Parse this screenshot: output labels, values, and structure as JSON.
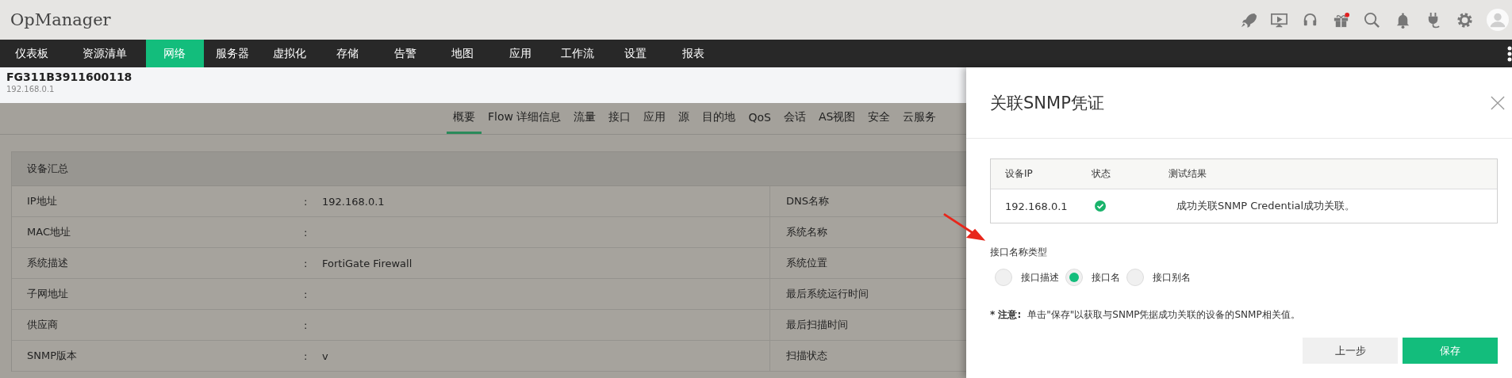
{
  "app": {
    "title": "OpManager"
  },
  "toolbar_icons": [
    {
      "kind": "rocket"
    },
    {
      "kind": "screen"
    },
    {
      "kind": "headset"
    },
    {
      "kind": "gift",
      "badge": true
    },
    {
      "kind": "search"
    },
    {
      "kind": "bell"
    },
    {
      "kind": "plug"
    },
    {
      "kind": "gear"
    },
    {
      "kind": "avatar"
    }
  ],
  "nav": [
    {
      "label": "仪表板",
      "selected": false
    },
    {
      "label": "资源清单",
      "selected": false
    },
    {
      "label": "网络",
      "selected": true
    },
    {
      "label": "服务器",
      "selected": false
    },
    {
      "label": "虚拟化",
      "selected": false
    },
    {
      "label": "存储",
      "selected": false
    },
    {
      "label": "告警",
      "selected": false
    },
    {
      "label": "地图",
      "selected": false
    },
    {
      "label": "应用",
      "selected": false
    },
    {
      "label": "工作流",
      "selected": false
    },
    {
      "label": "设置",
      "selected": false
    },
    {
      "label": "报表",
      "selected": false
    }
  ],
  "device": {
    "name": "FG311B3911600118",
    "ip": "192.168.0.1"
  },
  "sub_tabs": [
    {
      "label": "概要",
      "selected": true
    },
    {
      "label": "Flow 详细信息",
      "selected": false
    },
    {
      "label": "流量",
      "selected": false
    },
    {
      "label": "接口",
      "selected": false
    },
    {
      "label": "应用",
      "selected": false
    },
    {
      "label": "源",
      "selected": false
    },
    {
      "label": "目的地",
      "selected": false
    },
    {
      "label": "QoS",
      "selected": false
    },
    {
      "label": "会话",
      "selected": false
    },
    {
      "label": "AS视图",
      "selected": false
    },
    {
      "label": "安全",
      "selected": false
    },
    {
      "label": "云服务",
      "selected": false
    }
  ],
  "summary": {
    "title": "设备汇总",
    "rows": [
      {
        "label": "IP地址",
        "separator": ":",
        "value": "192.168.0.1",
        "right_label": "DNS名称"
      },
      {
        "label": "MAC地址",
        "separator": ":",
        "right_label": "系统名称"
      },
      {
        "label": "系统描述",
        "separator": ":",
        "value": "FortiGate Firewall",
        "right_label": "系统位置"
      },
      {
        "label": "子网地址",
        "separator": ":",
        "right_label": "最后系统运行时间"
      },
      {
        "label": "供应商",
        "separator": ":",
        "right_label": "最后扫描时间"
      },
      {
        "label": "SNMP版本",
        "separator": ":",
        "value": "v",
        "right_label": "扫描状态"
      }
    ]
  },
  "dialog": {
    "title": "关联SNMP凭证",
    "table": {
      "columns": [
        "设备IP",
        "状态",
        "测试结果"
      ],
      "rows": [
        {
          "ip": "192.168.0.1",
          "success": true,
          "result": "成功关联SNMP Credential成功关联。"
        }
      ]
    },
    "radio_group": {
      "label": "接口名称类型",
      "options": [
        {
          "label": "接口描述",
          "selected": false
        },
        {
          "label": "接口名",
          "selected": true
        },
        {
          "label": "接口别名",
          "selected": false
        }
      ]
    },
    "note": {
      "prefix": "* 注意:",
      "text": "单击\"保存\"以获取与SNMP凭据成功关联的设备的SNMP相关值。"
    },
    "buttons": [
      {
        "label": "上一步",
        "kind": "secondary"
      },
      {
        "label": "保存",
        "kind": "primary"
      }
    ]
  }
}
